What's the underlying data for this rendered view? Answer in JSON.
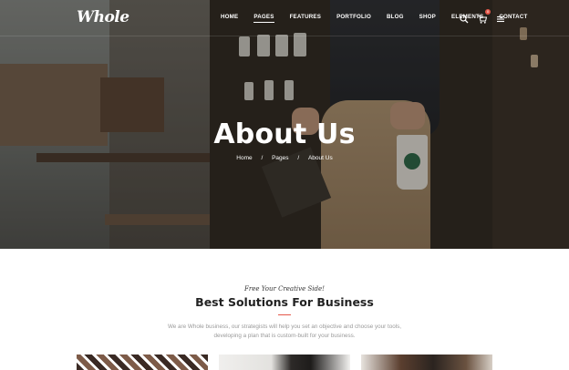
{
  "brand": {
    "logo_text": "Whole",
    "accent": "#e4584a"
  },
  "nav": {
    "items": [
      {
        "label": "HOME",
        "active": false
      },
      {
        "label": "PAGES",
        "active": true
      },
      {
        "label": "FEATURES",
        "active": false
      },
      {
        "label": "PORTFOLIO",
        "active": false
      },
      {
        "label": "BLOG",
        "active": false
      },
      {
        "label": "SHOP",
        "active": false
      },
      {
        "label": "ELEMENTS",
        "active": false
      },
      {
        "label": "CONTACT",
        "active": false
      }
    ],
    "icons": [
      "search-icon",
      "cart-icon",
      "menu-icon"
    ],
    "cart_count": "0"
  },
  "hero": {
    "title": "About Us",
    "breadcrumb": {
      "home": "Home",
      "sep1": "/",
      "pages": "Pages",
      "sep2": "/",
      "current": "About Us"
    }
  },
  "intro": {
    "tagline": "Free Your Creative Side!",
    "title": "Best Solutions For Business",
    "description": "We are Whole business, our strategists will help you set an objective and choose your tools, developing a plan that is custom-built for your business."
  }
}
